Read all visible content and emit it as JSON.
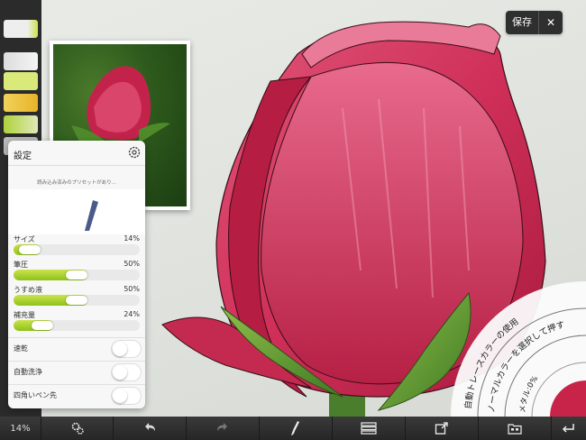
{
  "save_bar": {
    "save_label": "保存",
    "close_glyph": "✕"
  },
  "settings": {
    "title": "設定",
    "preset_text": "読み込み済みのプリセットがあり...",
    "sliders": [
      {
        "label": "サイズ",
        "value_text": "14%",
        "fraction": 0.14
      },
      {
        "label": "筆圧",
        "value_text": "50%",
        "fraction": 0.5
      },
      {
        "label": "うすめ液",
        "value_text": "50%",
        "fraction": 0.5
      },
      {
        "label": "補充量",
        "value_text": "24%",
        "fraction": 0.24
      }
    ],
    "toggles": [
      {
        "label": "速乾",
        "on": false
      },
      {
        "label": "自動洗浄",
        "on": false
      },
      {
        "label": "四角いペン先",
        "on": false
      }
    ]
  },
  "radial_menu": {
    "outer_text": "自動トレースカラーの使用",
    "middle_text": "ノーマルカラーを選択して押す",
    "inner_text": "メタル:0%",
    "color_swatch": "#c8244a"
  },
  "bottom_bar": {
    "zoom": "14%",
    "icons": [
      "gears-icon",
      "undo-icon",
      "redo-icon",
      "brush-icon",
      "layers-icon",
      "share-icon",
      "gallery-icon",
      "return-icon"
    ]
  },
  "colors": {
    "accent_green": "#8fc11b",
    "rose": "#c8244a",
    "toolbar": "#2b2b2b"
  }
}
